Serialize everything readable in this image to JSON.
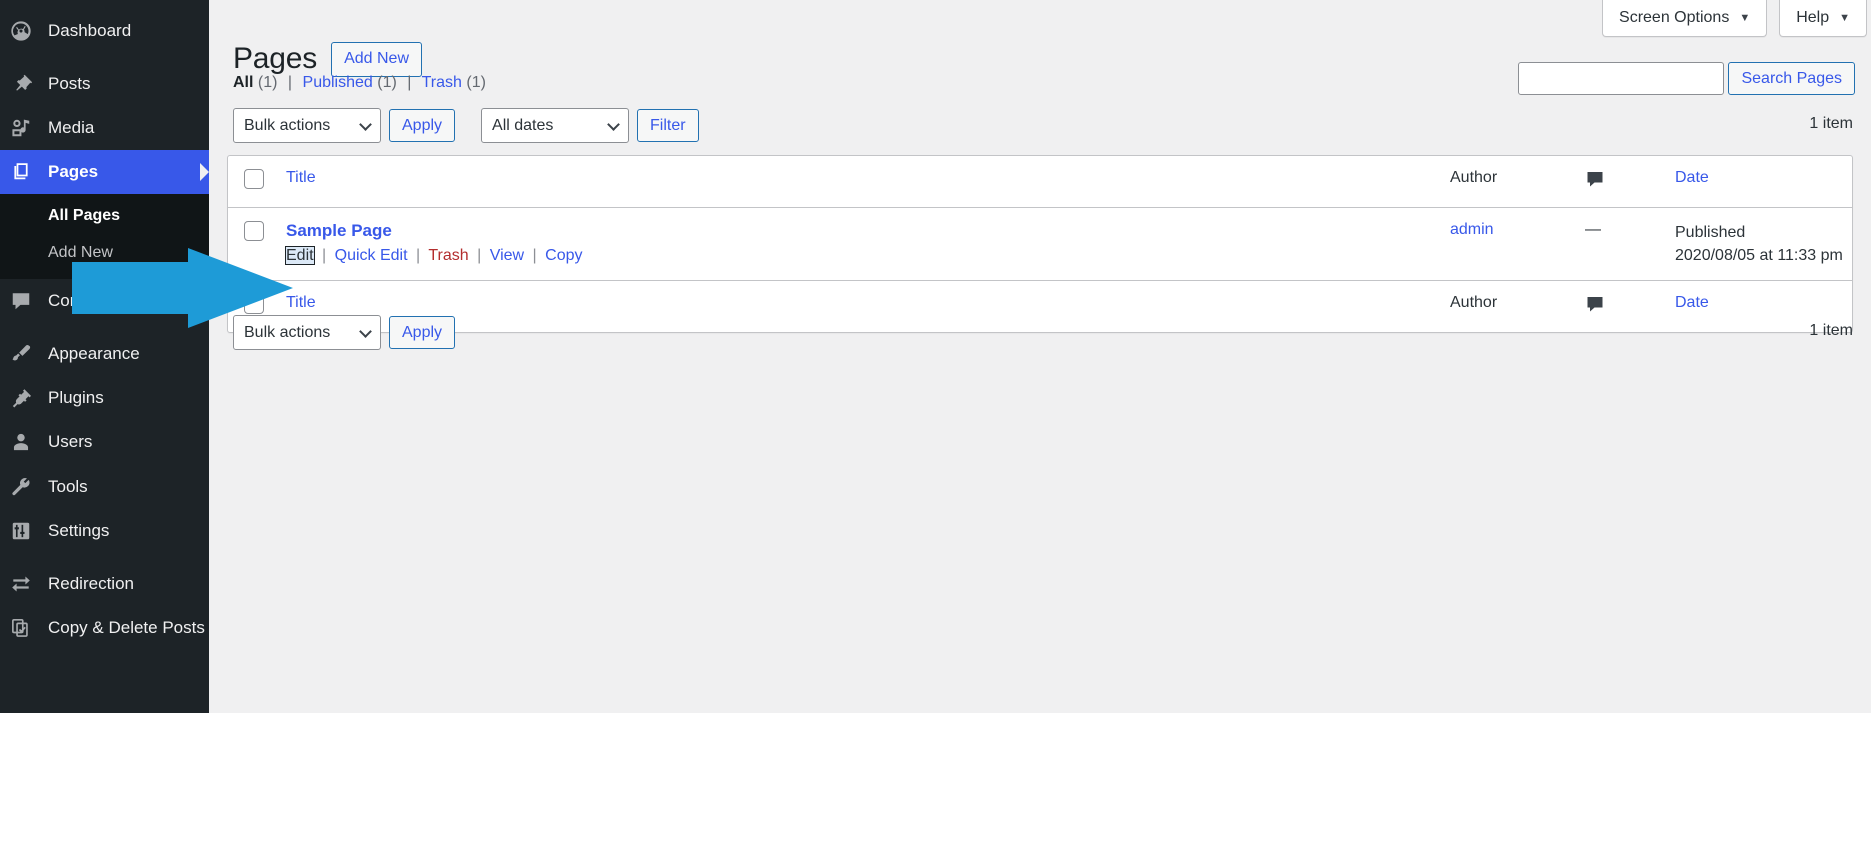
{
  "colors": {
    "sidebar_bg": "#1d2327",
    "submenu_bg": "#101517",
    "accent_blue": "#3858e9",
    "current_menu": "#3858e9",
    "content_bg": "#f0f0f1",
    "arrow": "#1e9bd7",
    "trash_red": "#b32d2e"
  },
  "sidebar": {
    "items": [
      {
        "label": "Dashboard",
        "icon": "dashboard-icon",
        "current": false
      },
      {
        "label": "Posts",
        "icon": "pin-icon",
        "current": false
      },
      {
        "label": "Media",
        "icon": "media-icon",
        "current": false
      },
      {
        "label": "Pages",
        "icon": "pages-icon",
        "current": true
      },
      {
        "label": "Comments",
        "icon": "comment-icon",
        "current": false
      },
      {
        "label": "Appearance",
        "icon": "brush-icon",
        "current": false
      },
      {
        "label": "Plugins",
        "icon": "plug-icon",
        "current": false
      },
      {
        "label": "Users",
        "icon": "user-icon",
        "current": false
      },
      {
        "label": "Tools",
        "icon": "wrench-icon",
        "current": false
      },
      {
        "label": "Settings",
        "icon": "settings-icon",
        "current": false
      },
      {
        "label": "Redirection",
        "icon": "redirection-icon",
        "current": false
      },
      {
        "label": "Copy & Delete Posts",
        "icon": "copy-delete-icon",
        "current": false
      }
    ],
    "submenu": [
      {
        "label": "All Pages",
        "current": true
      },
      {
        "label": "Add New",
        "current": false
      }
    ]
  },
  "screen_meta": {
    "screen_options_label": "Screen Options",
    "help_label": "Help",
    "caret": "▼"
  },
  "header": {
    "title": "Pages",
    "add_new_label": "Add New"
  },
  "views": {
    "all": {
      "label": "All",
      "count": "(1)",
      "current": true
    },
    "published": {
      "label": "Published",
      "count": "(1)",
      "current": false
    },
    "trash": {
      "label": "Trash",
      "count": "(1)",
      "current": false
    },
    "separator": "|"
  },
  "search": {
    "value": "",
    "placeholder": "",
    "button_label": "Search Pages"
  },
  "tablenav_top": {
    "bulk_actions_label": "Bulk actions",
    "apply_label": "Apply",
    "date_filter_label": "All dates",
    "filter_label": "Filter",
    "item_count": "1 item"
  },
  "tablenav_bottom": {
    "bulk_actions_label": "Bulk actions",
    "apply_label": "Apply",
    "item_count": "1 item"
  },
  "table": {
    "columns": {
      "title": "Title",
      "author": "Author",
      "comments": "comment-bubble-icon",
      "date": "Date"
    },
    "rows": [
      {
        "title": "Sample Page",
        "actions": [
          {
            "label": "Edit",
            "style": "focused"
          },
          {
            "label": "Quick Edit",
            "style": "normal"
          },
          {
            "label": "Trash",
            "style": "trash"
          },
          {
            "label": "View",
            "style": "normal"
          },
          {
            "label": "Copy",
            "style": "normal"
          }
        ],
        "action_divider": "|",
        "author": "admin",
        "comments": "—",
        "date_status": "Published",
        "date_value": "2020/08/05 at 11:33 pm"
      }
    ]
  },
  "overlay": {
    "arrow_name": "blue-arrow-annotation",
    "points_at": "Edit"
  }
}
